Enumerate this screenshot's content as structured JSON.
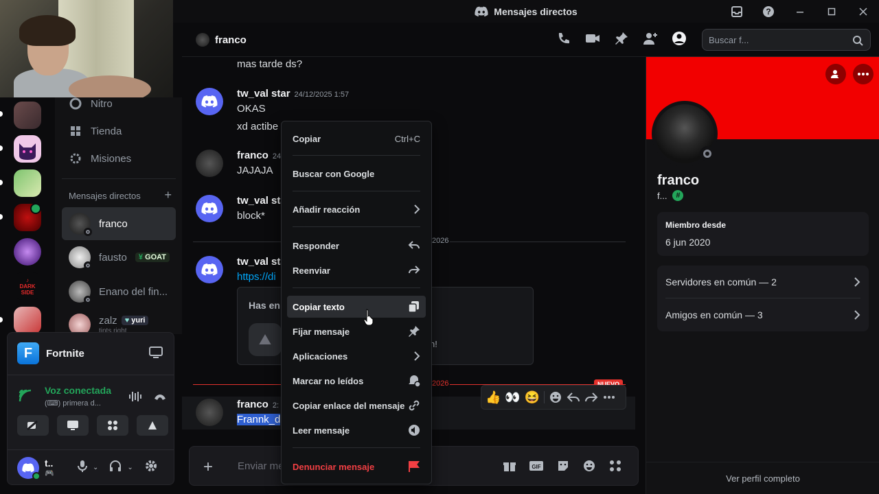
{
  "window": {
    "title": "Mensajes directos"
  },
  "sidebar": {
    "items": [
      {
        "label": "Nitro",
        "icon": "nitro-icon"
      },
      {
        "label": "Tienda",
        "icon": "shop-icon"
      },
      {
        "label": "Misiones",
        "icon": "quests-icon"
      }
    ],
    "dm_header": "Mensajes directos",
    "dms": [
      {
        "name": "franco",
        "badge": ""
      },
      {
        "name": "fausto",
        "badge": "GOAT"
      },
      {
        "name": "Enano del fin...",
        "badge": ""
      },
      {
        "name": "zalz",
        "badge": "yuri",
        "sub": "tints right"
      }
    ]
  },
  "activity": {
    "game": "Fortnite",
    "game_icon_letter": "F",
    "voice_status": "Voz conectada",
    "voice_channel": "primera d..."
  },
  "user": {
    "name": "t.."
  },
  "chat": {
    "channel_name": "franco",
    "search_placeholder": "Buscar f...",
    "messages": [
      {
        "text": "mas tarde ds?"
      },
      {
        "author": "tw_val star",
        "time": "24/12/2025 1:57",
        "lines": [
          "OKAS",
          "xd actibe"
        ]
      },
      {
        "author": "franco",
        "time": "24",
        "lines": [
          "JAJAJA"
        ]
      },
      {
        "author": "tw_val sta",
        "lines": [
          "block*"
        ]
      },
      {
        "date_divider": "2026"
      },
      {
        "author": "tw_val sta",
        "lines": [
          "https://di"
        ],
        "embed_title": "Has en",
        "embed_tail": "n!"
      },
      {
        "new_divider": "2026",
        "new_label": "NUEVO"
      },
      {
        "author": "franco",
        "time": "2:",
        "lines": [
          "Frannk_d"
        ]
      }
    ],
    "composer_placeholder": "Enviar me"
  },
  "context_menu": {
    "items": [
      {
        "label": "Copiar",
        "shortcut": "Ctrl+C"
      },
      {
        "label": "Buscar con Google"
      },
      {
        "label": "Añadir reacción"
      },
      {
        "label": "Responder"
      },
      {
        "label": "Reenviar"
      },
      {
        "label": "Copiar texto"
      },
      {
        "label": "Fijar mensaje"
      },
      {
        "label": "Aplicaciones"
      },
      {
        "label": "Marcar no leídos"
      },
      {
        "label": "Copiar enlace del mensaje"
      },
      {
        "label": "Leer mensaje"
      },
      {
        "label": "Denunciar mensaje"
      }
    ]
  },
  "profile": {
    "name": "franco",
    "tag": "f...",
    "member_since_label": "Miembro desde",
    "member_since": "6 jun 2020",
    "mutual_servers": "Servidores en común — 2",
    "mutual_friends": "Amigos en común — 3",
    "view_full": "Ver perfil completo",
    "banner_color": "#f20000"
  },
  "colors": {
    "accent": "#5865f2",
    "online": "#23a55a",
    "danger": "#f23f43",
    "selection": "#2f5fd0"
  }
}
